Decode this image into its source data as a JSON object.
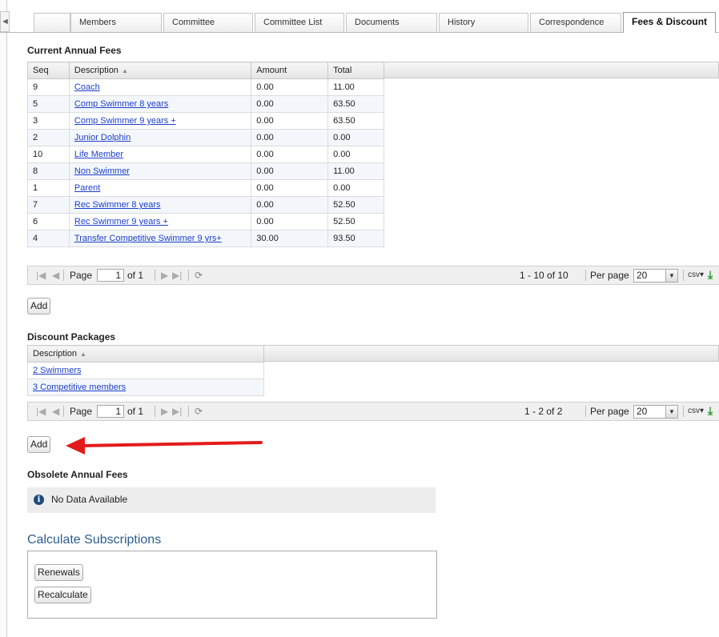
{
  "tabs": [
    {
      "label": "Members"
    },
    {
      "label": "Committee"
    },
    {
      "label": "Committee List"
    },
    {
      "label": "Documents"
    },
    {
      "label": "History"
    },
    {
      "label": "Correspondence"
    },
    {
      "label": "Fees & Discount",
      "active": true
    }
  ],
  "current_fees": {
    "title": "Current Annual Fees",
    "columns": [
      "Seq",
      "Description",
      "Amount",
      "Total"
    ],
    "rows": [
      {
        "seq": "9",
        "description": "Coach",
        "amount": "0.00",
        "total": "11.00"
      },
      {
        "seq": "5",
        "description": "Comp Swimmer 8 years",
        "amount": "0.00",
        "total": "63.50"
      },
      {
        "seq": "3",
        "description": "Comp Swimmer 9 years +",
        "amount": "0.00",
        "total": "63.50"
      },
      {
        "seq": "2",
        "description": "Junior Dolphin",
        "amount": "0.00",
        "total": "0.00"
      },
      {
        "seq": "10",
        "description": "Life Member",
        "amount": "0.00",
        "total": "0.00"
      },
      {
        "seq": "8",
        "description": "Non Swimmer",
        "amount": "0.00",
        "total": "11.00"
      },
      {
        "seq": "1",
        "description": "Parent",
        "amount": "0.00",
        "total": "0.00"
      },
      {
        "seq": "7",
        "description": "Rec Swimmer 8 years",
        "amount": "0.00",
        "total": "52.50"
      },
      {
        "seq": "6",
        "description": "Rec Swimmer 9 years +",
        "amount": "0.00",
        "total": "52.50"
      },
      {
        "seq": "4",
        "description": "Transfer Competitive Swimmer 9 yrs+",
        "amount": "30.00",
        "total": "93.50"
      }
    ],
    "pager": {
      "page_label": "Page",
      "page_value": "1",
      "of_label": "of 1",
      "summary": "1 - 10 of 10",
      "per_page_label": "Per page",
      "per_page_value": "20",
      "export_label": "csv"
    },
    "add_label": "Add"
  },
  "discount_packages": {
    "title": "Discount Packages",
    "columns": [
      "Description"
    ],
    "rows": [
      {
        "description": "2 Swimmers"
      },
      {
        "description": "3 Competitive members"
      }
    ],
    "pager": {
      "page_label": "Page",
      "page_value": "1",
      "of_label": "of 1",
      "summary": "1 - 2 of 2",
      "per_page_label": "Per page",
      "per_page_value": "20",
      "export_label": "csv"
    },
    "add_label": "Add"
  },
  "obsolete_fees": {
    "title": "Obsolete Annual Fees",
    "empty_text": "No Data Available"
  },
  "calculate": {
    "title": "Calculate Subscriptions",
    "renewals_label": "Renewals",
    "recalculate_label": "Recalculate"
  },
  "colors": {
    "link": "#1e40c8",
    "annotation_arrow": "#e31b1b",
    "section_heading_blue": "#2d5c8e"
  }
}
